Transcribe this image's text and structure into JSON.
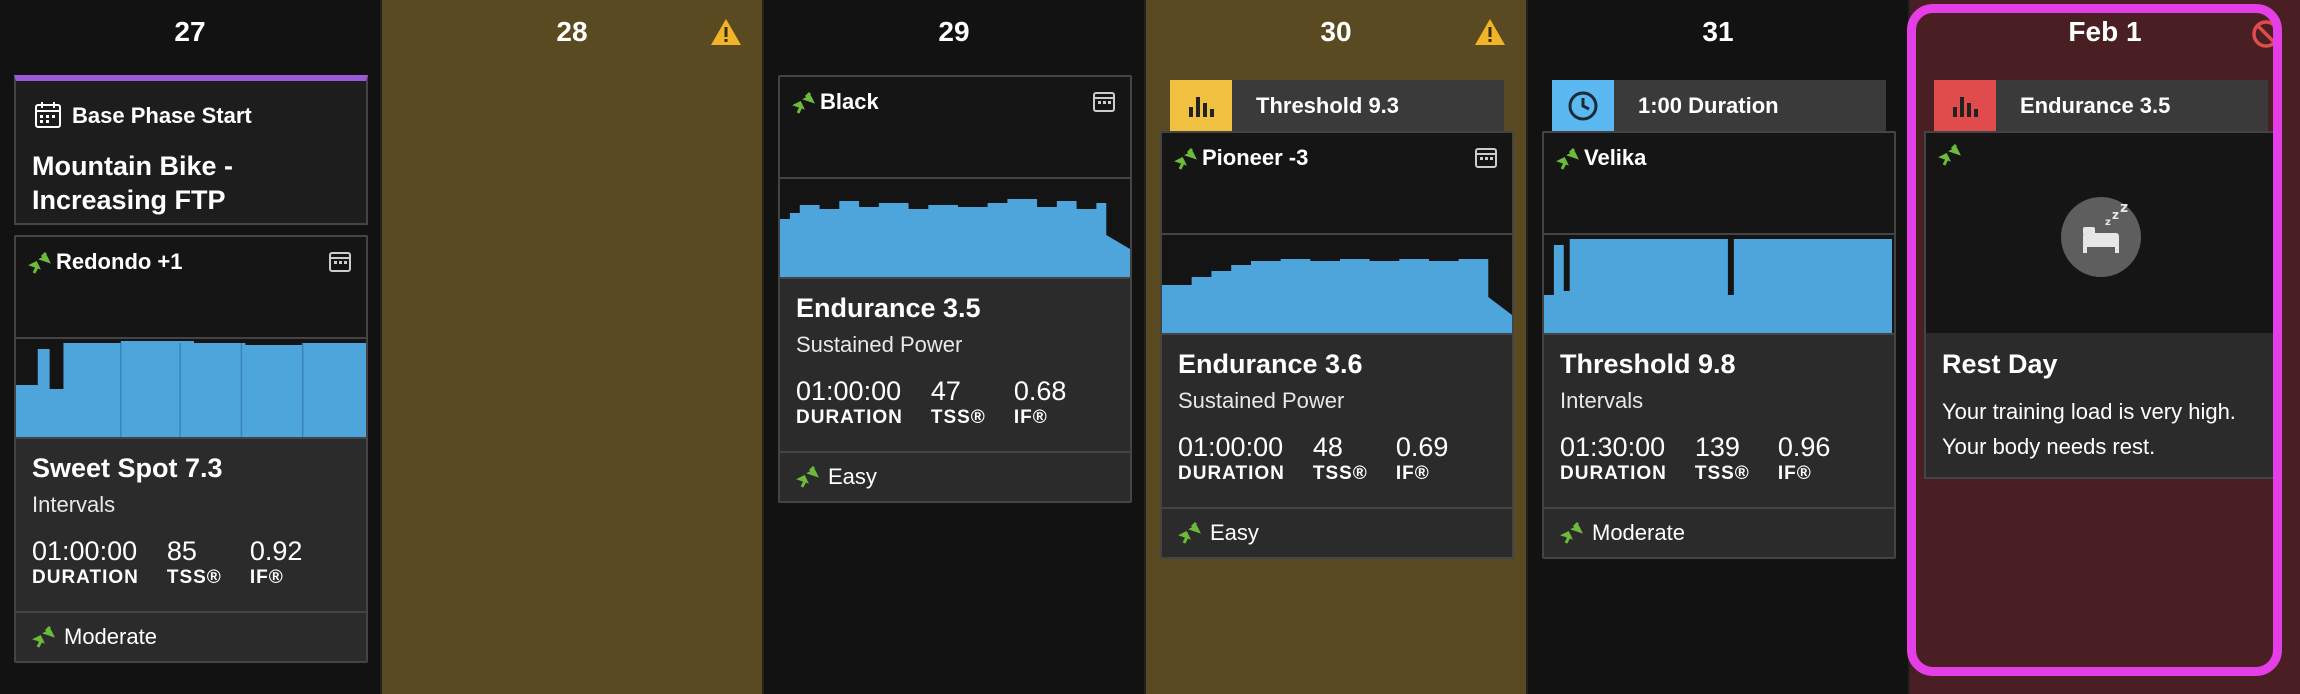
{
  "colors": {
    "warning_bg": "#5a4a22",
    "rest_bg": "#4a1f23",
    "selection": "#e43ee6",
    "power_profile": "#4ea5db",
    "event_accent": "#9b59d9",
    "warning_icon": "#f0b429",
    "chip_if": "#f0c040",
    "chip_duration": "#5bb8f0",
    "chip_red": "#e04b4b",
    "sparkle_green": "#6dbb3a"
  },
  "days": [
    {
      "label": "27"
    },
    {
      "label": "28",
      "warning": true
    },
    {
      "label": "29"
    },
    {
      "label": "30",
      "warning": true
    },
    {
      "label": "31"
    },
    {
      "label": "Feb 1",
      "blocked": true
    }
  ],
  "d27": {
    "event": {
      "type_label": "Base Phase Start",
      "name_line1": "Mountain Bike -",
      "name_line2": "Increasing FTP",
      "icon": "calendar-icon"
    },
    "workout": {
      "name": "Redondo +1",
      "title": "Sweet Spot 7.3",
      "subtitle": "Intervals",
      "duration": "01:00:00",
      "duration_label": "DURATION",
      "tss": "85",
      "tss_label": "TSS®",
      "if": "0.92",
      "if_label": "IF®",
      "difficulty": "Moderate"
    }
  },
  "d29": {
    "workout": {
      "name": "Black",
      "title": "Endurance 3.5",
      "subtitle": "Sustained Power",
      "duration": "01:00:00",
      "duration_label": "DURATION",
      "tss": "47",
      "tss_label": "TSS®",
      "if": "0.68",
      "if_label": "IF®",
      "difficulty": "Easy"
    }
  },
  "d30": {
    "chip": {
      "label": "Threshold 9.3",
      "icon": "bar-chart-icon"
    },
    "workout": {
      "name": "Pioneer -3",
      "title": "Endurance 3.6",
      "subtitle": "Sustained Power",
      "duration": "01:00:00",
      "duration_label": "DURATION",
      "tss": "48",
      "tss_label": "TSS®",
      "if": "0.69",
      "if_label": "IF®",
      "difficulty": "Easy"
    }
  },
  "d31": {
    "chip": {
      "label": "1:00 Duration",
      "icon": "clock-icon"
    },
    "workout": {
      "name": "Velika",
      "title": "Threshold 9.8",
      "subtitle": "Intervals",
      "duration": "01:30:00",
      "duration_label": "DURATION",
      "tss": "139",
      "tss_label": "TSS®",
      "if": "0.96",
      "if_label": "IF®",
      "difficulty": "Moderate"
    }
  },
  "feb1": {
    "chip": {
      "label": "Endurance 3.5",
      "icon": "bar-chart-icon"
    },
    "rest": {
      "title": "Rest Day",
      "msg_line1": "Your training load is very high.",
      "msg_line2": "Your body needs rest.",
      "icon": "sleeping-bed-icon"
    }
  }
}
